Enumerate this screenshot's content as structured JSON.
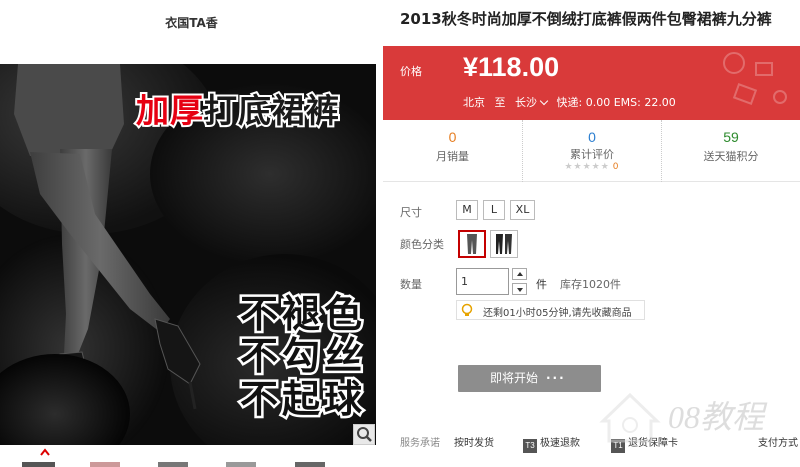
{
  "shop": {
    "name": "衣国TA香"
  },
  "banner": {
    "headline_red": "加厚",
    "headline_dark": "打底裙裤",
    "slogans": [
      "不褪色",
      "不勾丝",
      "不起球"
    ]
  },
  "product": {
    "title": "2013秋冬时尚加厚不倒绒打底裤假两件包臀裙裤九分裤"
  },
  "price": {
    "label": "价格",
    "value": "¥118.00",
    "ship_from": "北京",
    "ship_to_word": "至",
    "ship_to": "长沙",
    "shipping": "快递: 0.00 EMS: 22.00"
  },
  "stats": [
    {
      "value": "0",
      "label": "月销量"
    },
    {
      "value": "0",
      "label": "累计评价",
      "rating_count": "0"
    },
    {
      "value": "59",
      "label": "送天猫积分"
    }
  ],
  "attributes": {
    "size_label": "尺寸",
    "sizes": [
      "M",
      "L",
      "XL"
    ],
    "color_label": "颜色分类",
    "qty_label": "数量",
    "qty_value": "1",
    "unit": "件",
    "stock": "库存1020件",
    "reminder": "还剩01小时05分钟,请先收藏商品"
  },
  "action": {
    "soon_label": "即将开始",
    "soon_dots": "···"
  },
  "services": {
    "label": "服务承诺",
    "items": [
      {
        "text": "按时发货"
      },
      {
        "icon": "T3",
        "text": "极速退款"
      },
      {
        "icon": "T1",
        "text": "退货保障卡"
      },
      {
        "text": "支付方式"
      }
    ]
  },
  "watermark": {
    "text": "08教程"
  },
  "colors": {
    "price_bg": "#d93a3a",
    "accent_orange": "#e67e22",
    "stat_green": "#2e8b2e",
    "button_grey": "#8d8d8d"
  }
}
